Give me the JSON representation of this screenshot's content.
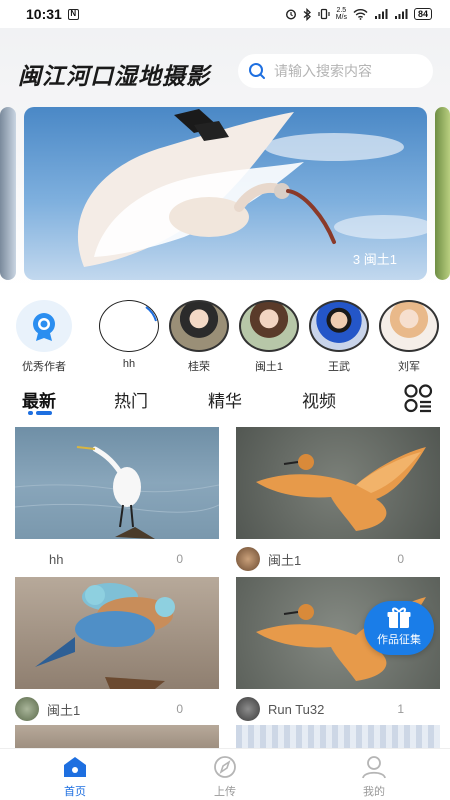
{
  "status_bar": {
    "time": "10:31",
    "speed": "2.5\nM/s",
    "battery": "84"
  },
  "header": {
    "title": "闽江河口湿地摄影",
    "search_placeholder": "请输入搜索内容"
  },
  "banner": {
    "caption": "3 闽土1"
  },
  "authors": {
    "featured_label": "优秀作者",
    "items": [
      {
        "name": "hh"
      },
      {
        "name": "桂荣"
      },
      {
        "name": "闽土1"
      },
      {
        "name": "王武"
      },
      {
        "name": "刘军"
      }
    ]
  },
  "tabs": [
    {
      "label": "最新"
    },
    {
      "label": "热门"
    },
    {
      "label": "精华"
    },
    {
      "label": "视频"
    }
  ],
  "posts": [
    {
      "user": "hh",
      "count": "0"
    },
    {
      "user": "闽土1",
      "count": "0"
    },
    {
      "user": "闽土1",
      "count": "0"
    },
    {
      "user": "Run Tu32",
      "count": "1"
    }
  ],
  "fab": {
    "label": "作品征集"
  },
  "bottom_nav": [
    {
      "label": "首页"
    },
    {
      "label": "上传"
    },
    {
      "label": "我的"
    }
  ],
  "colors": {
    "accent": "#1e6fe0",
    "fab": "#1a7de8"
  }
}
